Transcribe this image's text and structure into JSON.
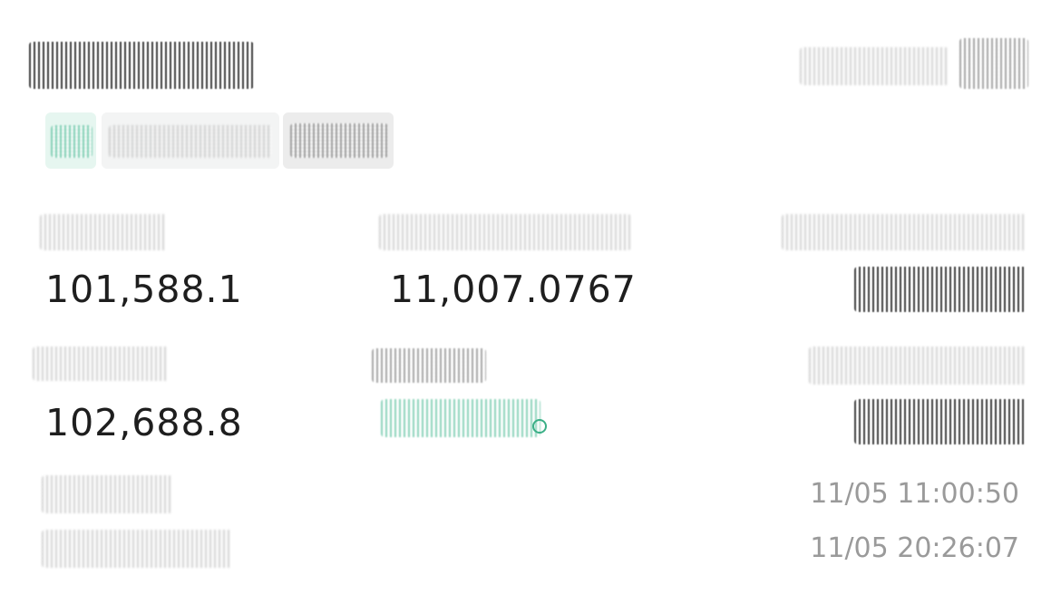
{
  "contract": {
    "title": "",
    "header_right_text": "",
    "tags": [
      "",
      "",
      ""
    ]
  },
  "stats": {
    "col1_row1": {
      "label": "",
      "value": "101,588.1"
    },
    "col2_row1": {
      "label": "",
      "value": "11,007.0767"
    },
    "col3_row1": {
      "label": "",
      "value": ""
    },
    "col1_row2": {
      "label": "",
      "value": "102,688.8"
    },
    "col2_row2": {
      "label": "",
      "value": ""
    },
    "col3_row2": {
      "label": "",
      "value": ""
    }
  },
  "times": {
    "row1": {
      "label": "",
      "value": "11/05 11:00:50"
    },
    "row2": {
      "label": "",
      "value": "11/05 20:26:07"
    }
  },
  "colors": {
    "accent": "#3aaf86",
    "text_primary": "#1e1e1e",
    "text_secondary": "#9a9a9a"
  }
}
